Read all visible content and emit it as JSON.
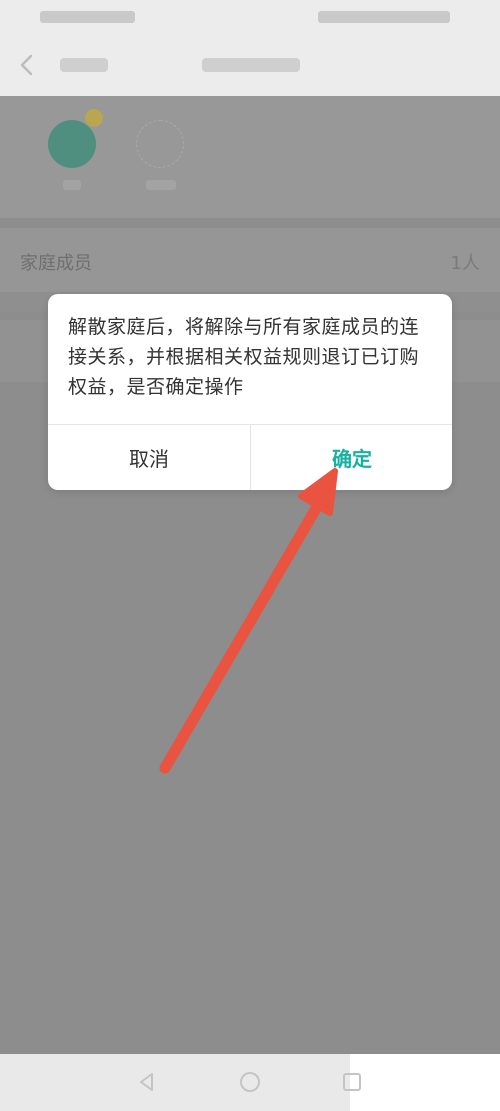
{
  "member_row": {
    "label": "家庭成员",
    "count": "1人"
  },
  "dialog": {
    "message": "解散家庭后，将解除与所有家庭成员的连接关系，并根据相关权益规则退订已订购权益，是否确定操作",
    "cancel_label": "取消",
    "confirm_label": "确定"
  },
  "colors": {
    "accent": "#16b29f",
    "annotation_arrow": "#e9533f",
    "overlay": "#8c8d8c"
  },
  "icons": {
    "back": "chevron-left-icon",
    "system_back": "triangle-back-icon",
    "system_home": "circle-home-icon"
  }
}
